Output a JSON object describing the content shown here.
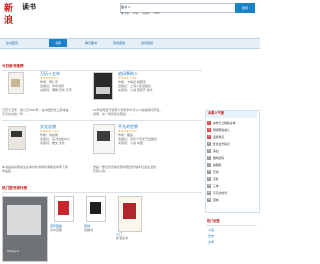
{
  "header": {
    "logo_text": "新浪",
    "site_name": "读书",
    "search_select": "图书",
    "search_button": "搜索",
    "radio_options": [
      "书名",
      "作者",
      "出版社",
      "ISBN"
    ]
  },
  "nav": {
    "items": [
      "读书首页",
      "书库",
      "每日图书",
      "原创连载",
      "资讯频道"
    ],
    "active_index": 1
  },
  "section_new": {
    "title": "今日新书推荐",
    "books": [
      {
        "title": "万历十五年",
        "rating": "★★★★★ 8.5",
        "meta": [
          "作者：黄仁宇",
          "出版社：中华书局",
          "关键词：明朝 历史 万历"
        ],
        "summary": [
          "万历十五年，即公元1587年，在中国历史上原本是",
          "平平淡淡的一年……"
        ]
      },
      {
        "title": "追风筝的人",
        "rating": "★★★★☆ 8.4",
        "meta": [
          "作者：卡勒德·胡赛尼",
          "出版社：上海人民出版社",
          "关键词：小说 阿富汗 成长"
        ],
        "summary": [
          "12岁的阿富汗富家少爷阿米尔与仆人哈桑情同手足。",
          "然而，在一场风筝比赛后……"
        ]
      }
    ]
  },
  "section_second": {
    "books": [
      {
        "title": "文化苦旅",
        "rating": "★★★★☆ 8.0",
        "meta": [
          "作者：余秋雨",
          "出版社：东方出版中心",
          "关键词：散文 文化"
        ],
        "summary": [
          "本书是余秋雨先生在海内外讲学和考察途中写下的",
          "作品集……"
        ]
      },
      {
        "title": "平凡的世界",
        "rating": "★★★★★ 9.0",
        "meta": [
          "作者：路遥",
          "出版社：北京十月文艺出版社",
          "关键词：小说 中国"
        ],
        "summary": [
          "这是一部全景式地表现中国当代城乡社会生活的",
          "长篇小说……"
        ]
      }
    ]
  },
  "section_bottom": {
    "title": "热门图书排行榜",
    "books": [
      {
        "title": "百年孤独",
        "author": "马尔克斯"
      },
      {
        "title": "围城",
        "author": "钱锺书"
      },
      {
        "title": "入门",
        "author": "新浪读书"
      }
    ],
    "side_caption": "Cheng Li"
  },
  "sidebar": {
    "title": "本周人气榜",
    "tabs": [
      "本周人气榜"
    ],
    "items": [
      {
        "rank": "1",
        "title": "鬼吹灯之精绝古城",
        "count": ""
      },
      {
        "rank": "2",
        "title": "明朝那些事儿",
        "count": ""
      },
      {
        "rank": "3",
        "title": "盗墓笔记",
        "count": ""
      },
      {
        "rank": "4",
        "title": "杜拉拉升职记",
        "count": ""
      },
      {
        "rank": "5",
        "title": "诛仙",
        "count": ""
      },
      {
        "rank": "6",
        "title": "藏地密码",
        "count": ""
      },
      {
        "rank": "7",
        "title": "狼图腾",
        "count": ""
      },
      {
        "rank": "8",
        "title": "兄弟",
        "count": ""
      },
      {
        "rank": "9",
        "title": "活着",
        "count": ""
      },
      {
        "rank": "10",
        "title": "三体",
        "count": ""
      },
      {
        "rank": "11",
        "title": "平凡的世界",
        "count": ""
      },
      {
        "rank": "12",
        "title": "围城",
        "count": ""
      }
    ],
    "tags_title": "热门标签",
    "tags": [
      "小说",
      "历史",
      "文学"
    ]
  }
}
